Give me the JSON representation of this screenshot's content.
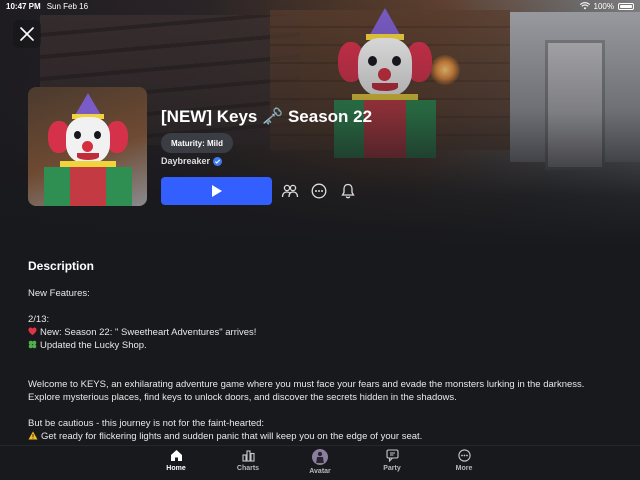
{
  "status_bar": {
    "time": "10:47 PM",
    "date": "Sun Feb 16",
    "battery": "100%",
    "icons": [
      "wifi-icon",
      "battery-icon"
    ]
  },
  "game": {
    "title": "[NEW] Keys 🗝️ Season 22",
    "maturity": "Maturity: Mild",
    "creator": "Daybreaker",
    "creator_verified": true
  },
  "actions": {
    "play_icon": "play-icon",
    "buttons": [
      "party-icon",
      "more-icon",
      "notify-bell-icon"
    ]
  },
  "description": {
    "heading": "Description",
    "line_features": "New Features:",
    "line_date": "2/13:",
    "line_season": "New: Season 22: \" Sweetheart Adventures\" arrives!",
    "line_shop": "Updated the Lucky Shop.",
    "line_welcome_1": "Welcome to KEYS, an exhilarating adventure game where you must face your fears and evade the monsters lurking in the darkness.",
    "line_welcome_2": "Explore mysterious places, find keys to unlock doors, and discover the secrets hidden in the shadows.",
    "line_caution": "But be cautious - this journey is not for the faint-hearted:",
    "line_warning": "Get ready for flickering lights and sudden panic that will keep you on the edge of your seat."
  },
  "tabs": [
    {
      "label": "Home",
      "icon": "home-icon",
      "active": true
    },
    {
      "label": "Charts",
      "icon": "charts-icon",
      "active": false
    },
    {
      "label": "Avatar",
      "icon": "avatar-icon",
      "active": false
    },
    {
      "label": "Party",
      "icon": "party-icon",
      "active": false
    },
    {
      "label": "More",
      "icon": "more-icon",
      "active": false
    }
  ],
  "colors": {
    "background": "#18191d",
    "play_button": "#335fff",
    "verified_badge": "#3d7cf0",
    "maturity_chip": "#3b3d44"
  }
}
